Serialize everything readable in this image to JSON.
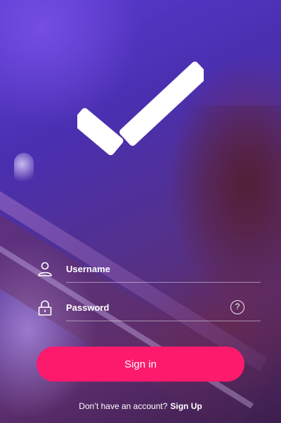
{
  "login": {
    "username_placeholder": "Username",
    "password_placeholder": "Password",
    "help_glyph": "?",
    "signin_label": "Sign in",
    "no_account_text": "Don’t have an account?",
    "signup_label": "Sign Up"
  },
  "icons": {
    "logo": "checkmark-icon",
    "username": "user-icon",
    "password": "lock-icon",
    "help": "question-icon"
  },
  "colors": {
    "accent": "#fb1a6b",
    "text": "#ffffff",
    "background": "#4a2fb0"
  }
}
